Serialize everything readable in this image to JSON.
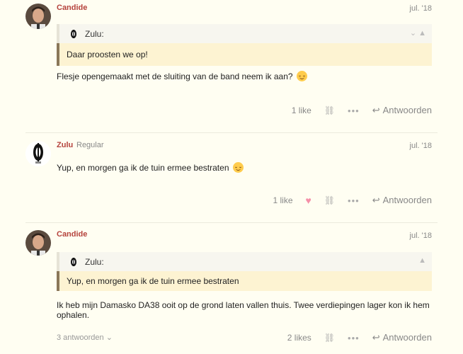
{
  "posts": [
    {
      "username": "Candide",
      "date": "jul. '18",
      "quote": {
        "user": "Zulu:",
        "text": "Daar proosten we op!"
      },
      "text": "Flesje opengemaakt met de sluiting van de band neem ik aan?",
      "likes": "1 like",
      "reply": "Antwoorden"
    },
    {
      "username": "Zulu",
      "usertitle": "Regular",
      "date": "jul. '18",
      "text": "Yup, en morgen ga ik de tuin ermee bestraten",
      "likes": "1 like",
      "reply": "Antwoorden"
    },
    {
      "username": "Candide",
      "date": "jul. '18",
      "quote": {
        "user": "Zulu:",
        "text": "Yup, en morgen ga ik de tuin ermee bestraten"
      },
      "text": "Ik heb mijn Damasko DA38 ooit op de grond laten vallen thuis. Twee verdiepingen lager kon ik hem ophalen.",
      "replies": "3 antwoorden",
      "likes": "2 likes",
      "reply": "Antwoorden"
    }
  ],
  "colors": {
    "username": "#b5423c",
    "quote_accent": "#8a7759",
    "quote_bg": "#fdf3d2",
    "heart": "#f58fa8"
  }
}
